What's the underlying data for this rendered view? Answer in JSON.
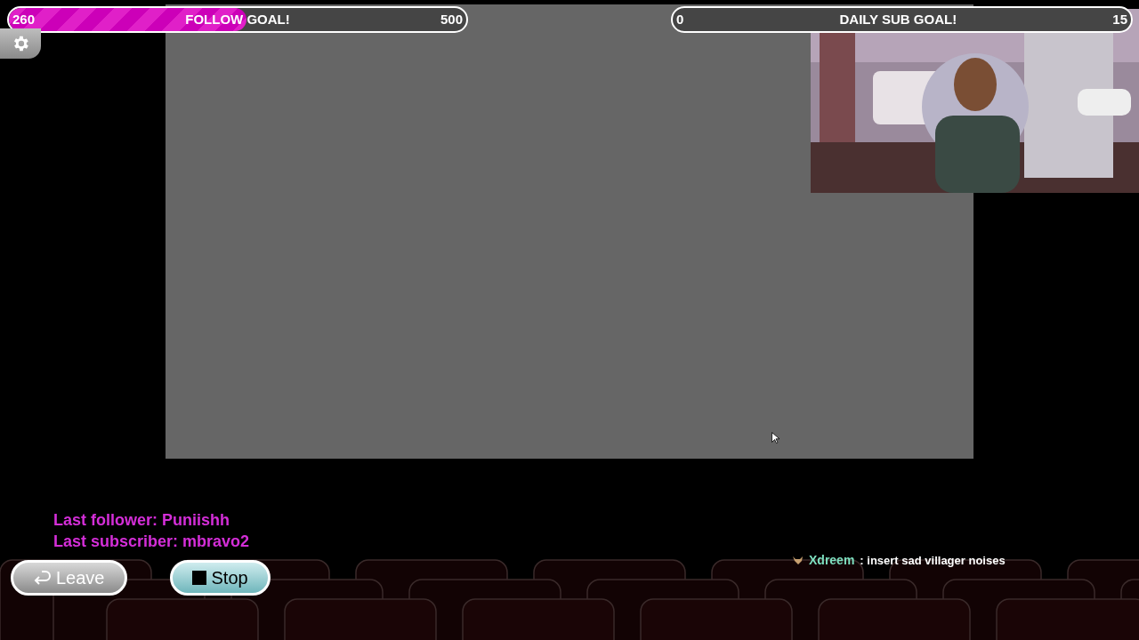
{
  "goals": [
    {
      "start": "260",
      "title": "FOLLOW GOAL!",
      "target": "500",
      "level": 0.52
    },
    {
      "start": "0",
      "title": "DAILY SUB GOAL!",
      "target": "15",
      "level": 0
    }
  ],
  "chat": [
    {
      "user": "Xdreem",
      "message": ": insert sad villager noises",
      "color": "#7ee0c0"
    }
  ],
  "recent": [
    "Last follower: Puniishh",
    "Last subscriber: mbravo2"
  ],
  "buttons": [
    {
      "label": "Leave",
      "kind": "leave"
    },
    {
      "label": "Stop",
      "kind": "stop"
    }
  ]
}
